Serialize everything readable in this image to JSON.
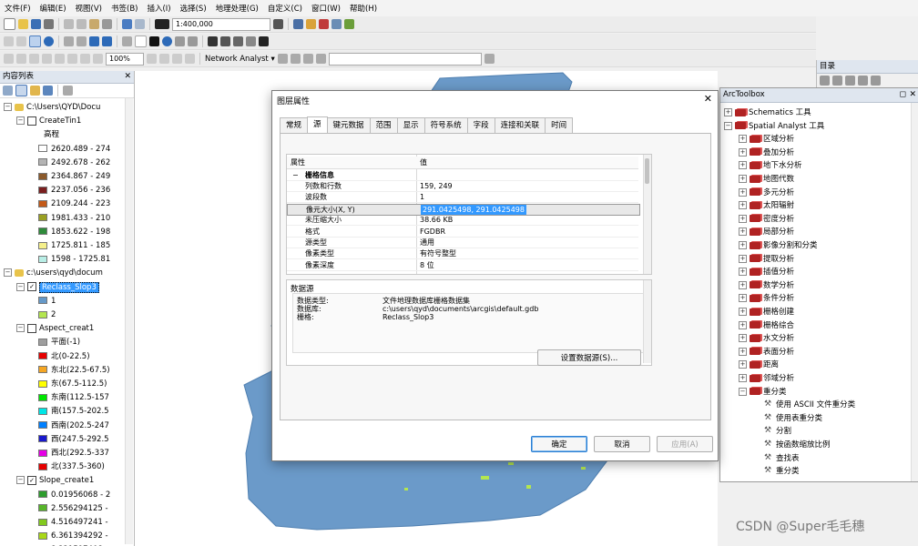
{
  "menu": [
    "文件(F)",
    "编辑(E)",
    "视图(V)",
    "书签(B)",
    "插入(I)",
    "选择(S)",
    "地理处理(G)",
    "自定义(C)",
    "窗口(W)",
    "帮助(H)"
  ],
  "toolbar": {
    "scale": "1:400,000",
    "zoom": "100%",
    "network_analyst": "Network Analyst ▾"
  },
  "toc": {
    "title": "内容列表",
    "rows": [
      {
        "text": "C:\\Users\\QYD\\Docu",
        "type": "folder"
      },
      {
        "text": "CreateTin1",
        "type": "layer"
      },
      {
        "text": "高程",
        "type": "label"
      },
      {
        "text": "2620.489 - 274",
        "color": "#ffffff"
      },
      {
        "text": "2492.678 - 262",
        "color": "#b4b4b4"
      },
      {
        "text": "2364.867 - 249",
        "color": "#8b5a2b"
      },
      {
        "text": "2237.056 - 236",
        "color": "#7a1f1f"
      },
      {
        "text": "2109.244 - 223",
        "color": "#c45a18"
      },
      {
        "text": "1981.433 - 210",
        "color": "#9aa022"
      },
      {
        "text": "1853.622 - 198",
        "color": "#2e8b3a"
      },
      {
        "text": "1725.811 - 185",
        "color": "#f5f08c"
      },
      {
        "text": "1598 - 1725.81",
        "color": "#b8eee6"
      },
      {
        "text": "c:\\users\\qyd\\docum",
        "type": "folder"
      },
      {
        "text": "Reclass_Slop3",
        "type": "layer-checked-selected"
      },
      {
        "text": "1",
        "color": "#6699c8"
      },
      {
        "text": "2",
        "color": "#b4e650"
      },
      {
        "text": "Aspect_creat1",
        "type": "layer"
      },
      {
        "text": "平面(-1)",
        "color": "#9e9e9e"
      },
      {
        "text": "北(0-22.5)",
        "color": "#e60000"
      },
      {
        "text": "东北(22.5-67.5)",
        "color": "#f5a623"
      },
      {
        "text": "东(67.5-112.5)",
        "color": "#ffff00"
      },
      {
        "text": "东南(112.5-157",
        "color": "#00e600"
      },
      {
        "text": "南(157.5-202.5",
        "color": "#00e6e6"
      },
      {
        "text": "西南(202.5-247",
        "color": "#0080ff"
      },
      {
        "text": "西(247.5-292.5",
        "color": "#1a1acc"
      },
      {
        "text": "西北(292.5-337",
        "color": "#e600e6"
      },
      {
        "text": "北(337.5-360)",
        "color": "#e60000"
      },
      {
        "text": "Slope_create1",
        "type": "layer-checked"
      },
      {
        "text": "0.01956068 - 2",
        "color": "#2e9e2e"
      },
      {
        "text": "2.556294125 -",
        "color": "#57b52a"
      },
      {
        "text": "4.516497241 -",
        "color": "#82c91e"
      },
      {
        "text": "6.361394292 -",
        "color": "#a9d818"
      },
      {
        "text": "8.321597408 -",
        "color": "#d3e614"
      }
    ]
  },
  "dialog": {
    "title": "图层属性",
    "close": "✕",
    "tabs": [
      "常规",
      "源",
      "键元数据",
      "范围",
      "显示",
      "符号系统",
      "字段",
      "连接和关联",
      "时间"
    ],
    "active_tab": "源",
    "grid_header": {
      "name": "属性",
      "value": "值"
    },
    "section": "栅格信息",
    "properties": [
      {
        "name": "列数和行数",
        "value": "159, 249"
      },
      {
        "name": "波段数",
        "value": "1"
      },
      {
        "name": "像元大小(X, Y)",
        "value": "291.0425498, 291.0425498"
      },
      {
        "name": "未压缩大小",
        "value": "38.66 KB"
      },
      {
        "name": "格式",
        "value": "FGDBR"
      },
      {
        "name": "源类型",
        "value": "通用"
      },
      {
        "name": "像素类型",
        "value": "有符号整型"
      },
      {
        "name": "像素深度",
        "value": "8 位"
      }
    ],
    "source_label": "数据源",
    "source": [
      {
        "name": "数据类型:",
        "value": "文件地理数据库栅格数据集"
      },
      {
        "name": "数据库:",
        "value": "c:\\users\\qyd\\documents\\arcgis\\default.gdb"
      },
      {
        "name": "栅格:",
        "value": "Reclass_Slop3"
      }
    ],
    "set_source_button": "设置数据源(S)...",
    "ok": "确定",
    "cancel": "取消",
    "apply": "应用(A)"
  },
  "catalog": {
    "title": "目录"
  },
  "arctoolbox": {
    "title": "ArcToolbox",
    "rows": [
      {
        "text": "Schematics 工具",
        "level": 0,
        "kind": "box",
        "exp": "+"
      },
      {
        "text": "Spatial Analyst 工具",
        "level": 0,
        "kind": "box",
        "exp": "−"
      },
      {
        "text": "区域分析",
        "level": 1,
        "kind": "box",
        "exp": "+"
      },
      {
        "text": "叠加分析",
        "level": 1,
        "kind": "box",
        "exp": "+"
      },
      {
        "text": "地下水分析",
        "level": 1,
        "kind": "box",
        "exp": "+"
      },
      {
        "text": "地图代数",
        "level": 1,
        "kind": "box",
        "exp": "+"
      },
      {
        "text": "多元分析",
        "level": 1,
        "kind": "box",
        "exp": "+"
      },
      {
        "text": "太阳辐射",
        "level": 1,
        "kind": "box",
        "exp": "+"
      },
      {
        "text": "密度分析",
        "level": 1,
        "kind": "box",
        "exp": "+"
      },
      {
        "text": "局部分析",
        "level": 1,
        "kind": "box",
        "exp": "+"
      },
      {
        "text": "影像分割和分类",
        "level": 1,
        "kind": "box",
        "exp": "+"
      },
      {
        "text": "提取分析",
        "level": 1,
        "kind": "box",
        "exp": "+"
      },
      {
        "text": "插值分析",
        "level": 1,
        "kind": "box",
        "exp": "+"
      },
      {
        "text": "数学分析",
        "level": 1,
        "kind": "box",
        "exp": "+"
      },
      {
        "text": "条件分析",
        "level": 1,
        "kind": "box",
        "exp": "+"
      },
      {
        "text": "栅格创建",
        "level": 1,
        "kind": "box",
        "exp": "+"
      },
      {
        "text": "栅格综合",
        "level": 1,
        "kind": "box",
        "exp": "+"
      },
      {
        "text": "水文分析",
        "level": 1,
        "kind": "box",
        "exp": "+"
      },
      {
        "text": "表面分析",
        "level": 1,
        "kind": "box",
        "exp": "+"
      },
      {
        "text": "距离",
        "level": 1,
        "kind": "box",
        "exp": "+"
      },
      {
        "text": "邻域分析",
        "level": 1,
        "kind": "box",
        "exp": "+"
      },
      {
        "text": "重分类",
        "level": 1,
        "kind": "box",
        "exp": "−"
      },
      {
        "text": "使用 ASCII 文件重分类",
        "level": 2,
        "kind": "tool"
      },
      {
        "text": "使用表重分类",
        "level": 2,
        "kind": "tool"
      },
      {
        "text": "分割",
        "level": 2,
        "kind": "tool"
      },
      {
        "text": "按函数缩放比例",
        "level": 2,
        "kind": "tool"
      },
      {
        "text": "查找表",
        "level": 2,
        "kind": "tool"
      },
      {
        "text": "重分类",
        "level": 2,
        "kind": "tool"
      }
    ]
  },
  "watermark": "CSDN @Super毛毛穗"
}
